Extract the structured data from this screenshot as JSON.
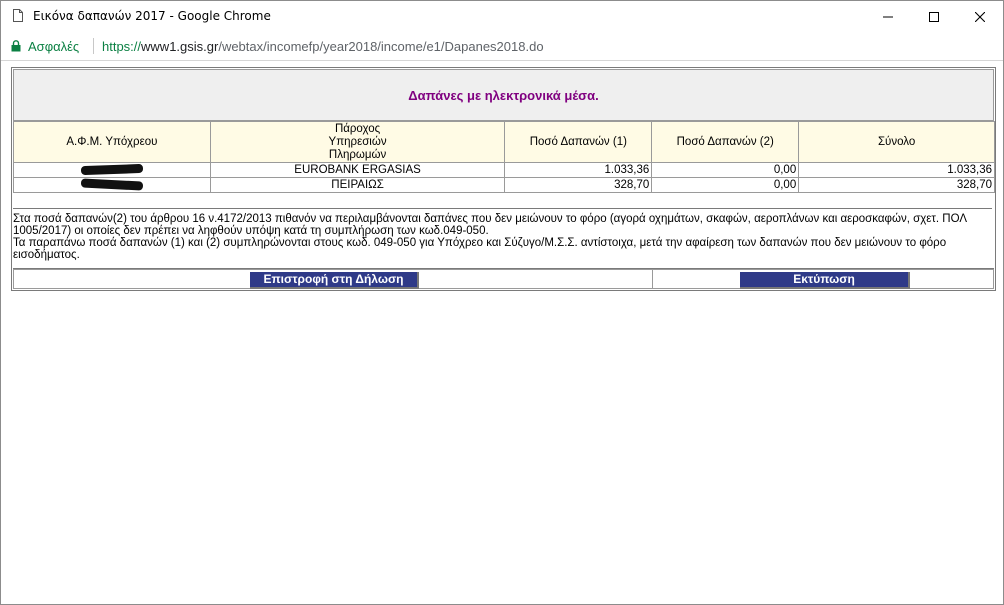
{
  "window": {
    "title": "Εικόνα δαπανών 2017 - Google Chrome"
  },
  "address_bar": {
    "secure_label": "Ασφαλές",
    "url_scheme": "https://",
    "url_host": "www1.gsis.gr",
    "url_path": "/webtax/incomefp/year2018/income/e1/Dapanes2018.do"
  },
  "page": {
    "heading": "Δαπάνες με ηλεκτρονικά μέσα.",
    "columns": [
      "Α.Φ.Μ. Υπόχρεου",
      "Πάροχος Υπηρεσιών Πληρωμών",
      "Ποσό Δαπανών (1)",
      "Ποσό Δαπανών (2)",
      "Σύνολο"
    ],
    "rows": [
      {
        "provider": "EUROBANK ERGASIAS",
        "amount1": "1.033,36",
        "amount2": "0,00",
        "total": "1.033,36"
      },
      {
        "provider": "ΠΕΙΡΑΙΩΣ",
        "amount1": "328,70",
        "amount2": "0,00",
        "total": "328,70"
      }
    ],
    "note1": "Στα ποσά δαπανών(2) του άρθρου 16 ν.4172/2013 πιθανόν να περιλαμβάνονται δαπάνες που δεν μειώνουν το φόρο (αγορά οχημάτων, σκαφών, αεροπλάνων και αεροσκαφών, σχετ. ΠΟΛ 1005/2017) οι οποίες δεν πρέπει να ληφθούν υπόψη κατά τη συμπλήρωση των κωδ.049-050.",
    "note2": "Τα παραπάνω ποσά δαπανών (1) και (2) συμπληρώνονται στους κωδ. 049-050 για Υπόχρεο και Σύζυγο/Μ.Σ.Σ. αντίστοιχα, μετά την αφαίρεση των δαπανών που δεν μειώνουν το φόρο εισοδήματος.",
    "back_button": "Επιστροφή στη Δήλωση",
    "print_button": "Εκτύπωση"
  }
}
